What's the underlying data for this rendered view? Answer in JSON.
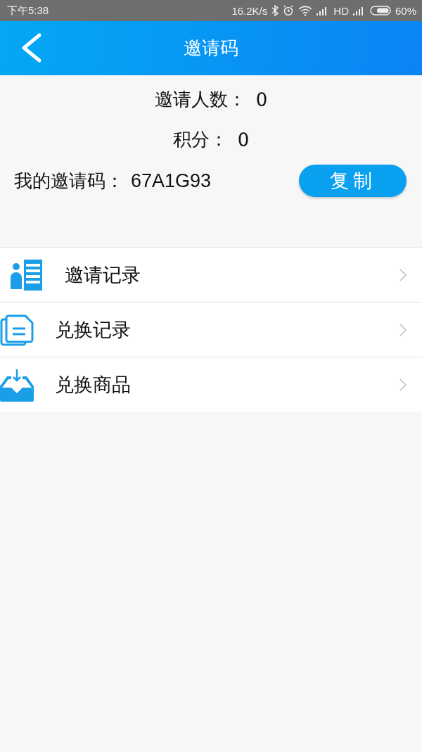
{
  "status_bar": {
    "time": "下午5:38",
    "speed": "16.2K/s",
    "network": "HD",
    "battery": "60%"
  },
  "header": {
    "title": "邀请码"
  },
  "stats": [
    {
      "label": "邀请人数：",
      "value": "0"
    },
    {
      "label": "积分：",
      "value": "0"
    }
  ],
  "invite_code": {
    "label": "我的邀请码：",
    "value": "67A1G93",
    "button": "复制"
  },
  "menu": [
    {
      "kind": "people",
      "label": "邀请记录"
    },
    {
      "kind": "docs",
      "label": "兑换记录"
    },
    {
      "kind": "inbox",
      "label": "兑换商品"
    }
  ]
}
